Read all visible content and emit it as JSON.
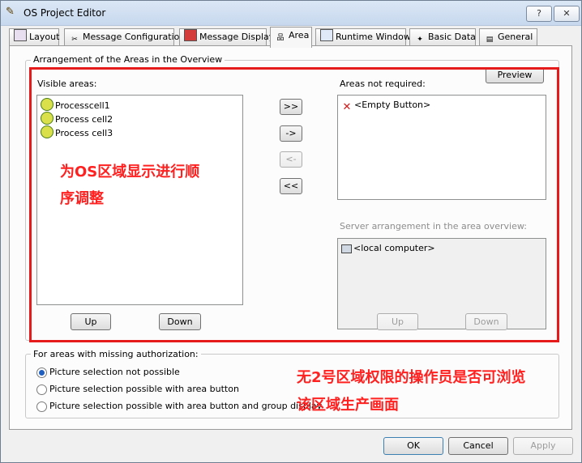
{
  "window": {
    "title": "OS Project Editor",
    "help_label": "?",
    "close_label": "✕"
  },
  "tabs": [
    {
      "label": "Layout",
      "icon": "layout-icon"
    },
    {
      "label": "Message Configuration",
      "icon": "message-config-icon"
    },
    {
      "label": "Message Display",
      "icon": "message-display-icon"
    },
    {
      "label": "Area",
      "icon": "area-icon"
    },
    {
      "label": "Runtime Window",
      "icon": "runtime-window-icon"
    },
    {
      "label": "Basic Data",
      "icon": "basic-data-icon"
    },
    {
      "label": "General",
      "icon": "general-icon"
    }
  ],
  "arrangement": {
    "legend": "Arrangement of the Areas in the Overview",
    "preview_label": "Preview",
    "visible_label": "Visible areas:",
    "visible_items": [
      "Processcell1",
      "Process cell2",
      "Process cell3"
    ],
    "not_required_label": "Areas not required:",
    "not_required_items": [
      "<Empty Button>"
    ],
    "move_all_right": ">>",
    "move_right": "->",
    "move_left": "<-",
    "move_all_left": "<<",
    "server_label": "Server arrangement in the area overview:",
    "server_items": [
      "<local computer>"
    ],
    "up_label": "Up",
    "down_label": "Down",
    "server_up_label": "Up",
    "server_down_label": "Down"
  },
  "authorization": {
    "legend": "For areas with missing authorization:",
    "options": [
      {
        "label": "Picture selection not possible",
        "checked": true
      },
      {
        "label": "Picture selection possible with area button",
        "checked": false
      },
      {
        "label": "Picture selection possible with area button and group display",
        "checked": false
      }
    ]
  },
  "annotations": {
    "left_line1": "为OS区域显示进行顺",
    "left_line2": "序调整",
    "right_line1": "无2号区域权限的操作员是否可浏览",
    "right_line2": "该区域生产画面"
  },
  "footer": {
    "ok_label": "OK",
    "cancel_label": "Cancel",
    "apply_label": "Apply"
  },
  "colors": {
    "annotation": "#ff2020",
    "highlight_box": "#e51a1a"
  }
}
